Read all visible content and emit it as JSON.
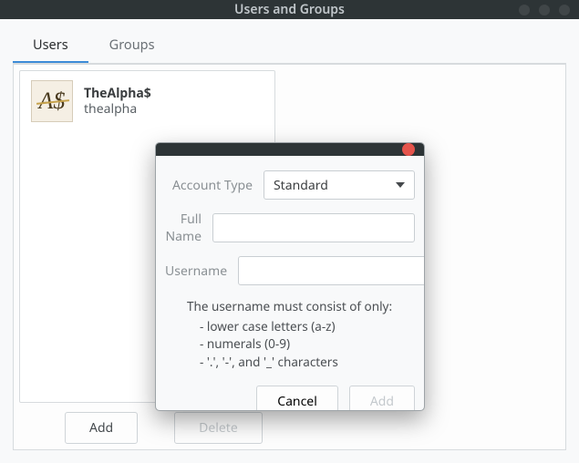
{
  "window": {
    "title": "Users and Groups"
  },
  "tabs": {
    "users": "Users",
    "groups": "Groups",
    "active": "users"
  },
  "user_list": {
    "items": [
      {
        "display_name": "TheAlpha$",
        "login": "thealpha",
        "avatar_glyph": "A$"
      }
    ]
  },
  "main_buttons": {
    "add": "Add",
    "delete": "Delete",
    "delete_enabled": false
  },
  "dialog": {
    "fields": {
      "account_type_label": "Account Type",
      "account_type_value": "Standard",
      "full_name_label": "Full Name",
      "full_name_value": "",
      "username_label": "Username",
      "username_value": ""
    },
    "hint": {
      "header": "The username must consist of only:",
      "rules": [
        "lower case letters (a-z)",
        "numerals (0-9)",
        "'.', '-', and '_' characters"
      ]
    },
    "actions": {
      "cancel": "Cancel",
      "add": "Add",
      "add_enabled": false
    }
  }
}
